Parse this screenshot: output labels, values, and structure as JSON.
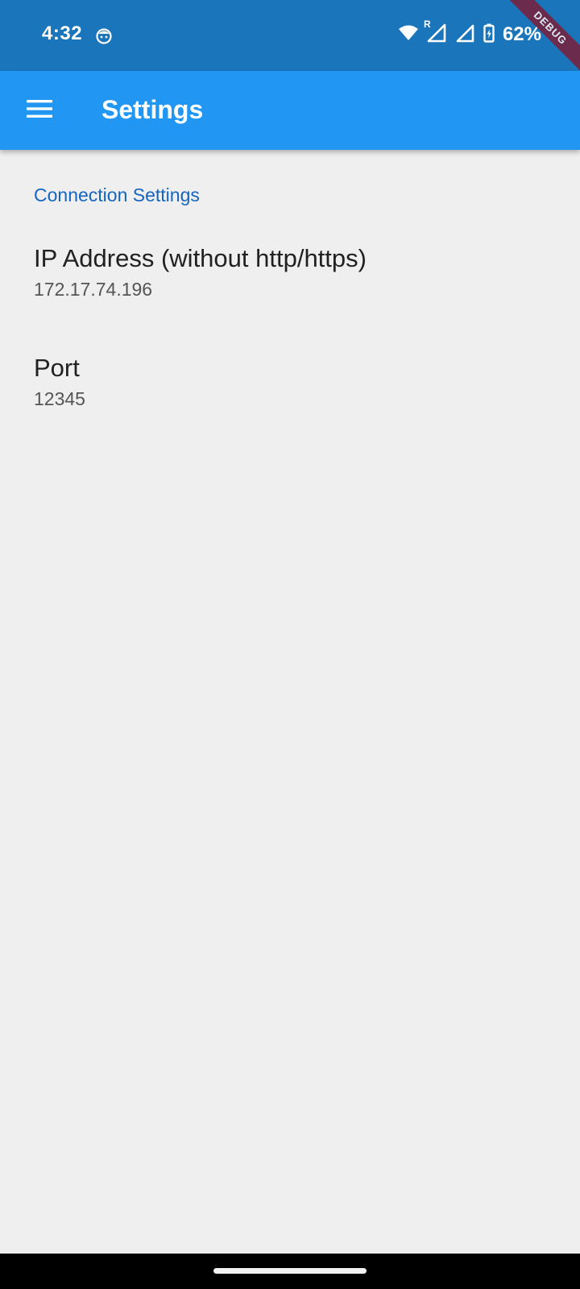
{
  "status_bar": {
    "time": "4:32",
    "battery_percent": "62%",
    "roaming_indicator": "R",
    "icons": [
      "face-icon",
      "wifi-icon",
      "signal-icon",
      "battery-charging-icon"
    ]
  },
  "debug_banner": "DEBUG",
  "app_bar": {
    "title": "Settings",
    "menu_icon": "menu-icon"
  },
  "sections": [
    {
      "header": "Connection Settings",
      "items": [
        {
          "title": "IP Address (without http/https)",
          "value": "172.17.74.196"
        },
        {
          "title": "Port",
          "value": "12345"
        }
      ]
    }
  ],
  "colors": {
    "status_bar": "#1b75bb",
    "app_bar": "#2196f3",
    "section_header": "#1565c0",
    "background": "#efefef",
    "debug_ribbon": "#7a1f3a"
  }
}
